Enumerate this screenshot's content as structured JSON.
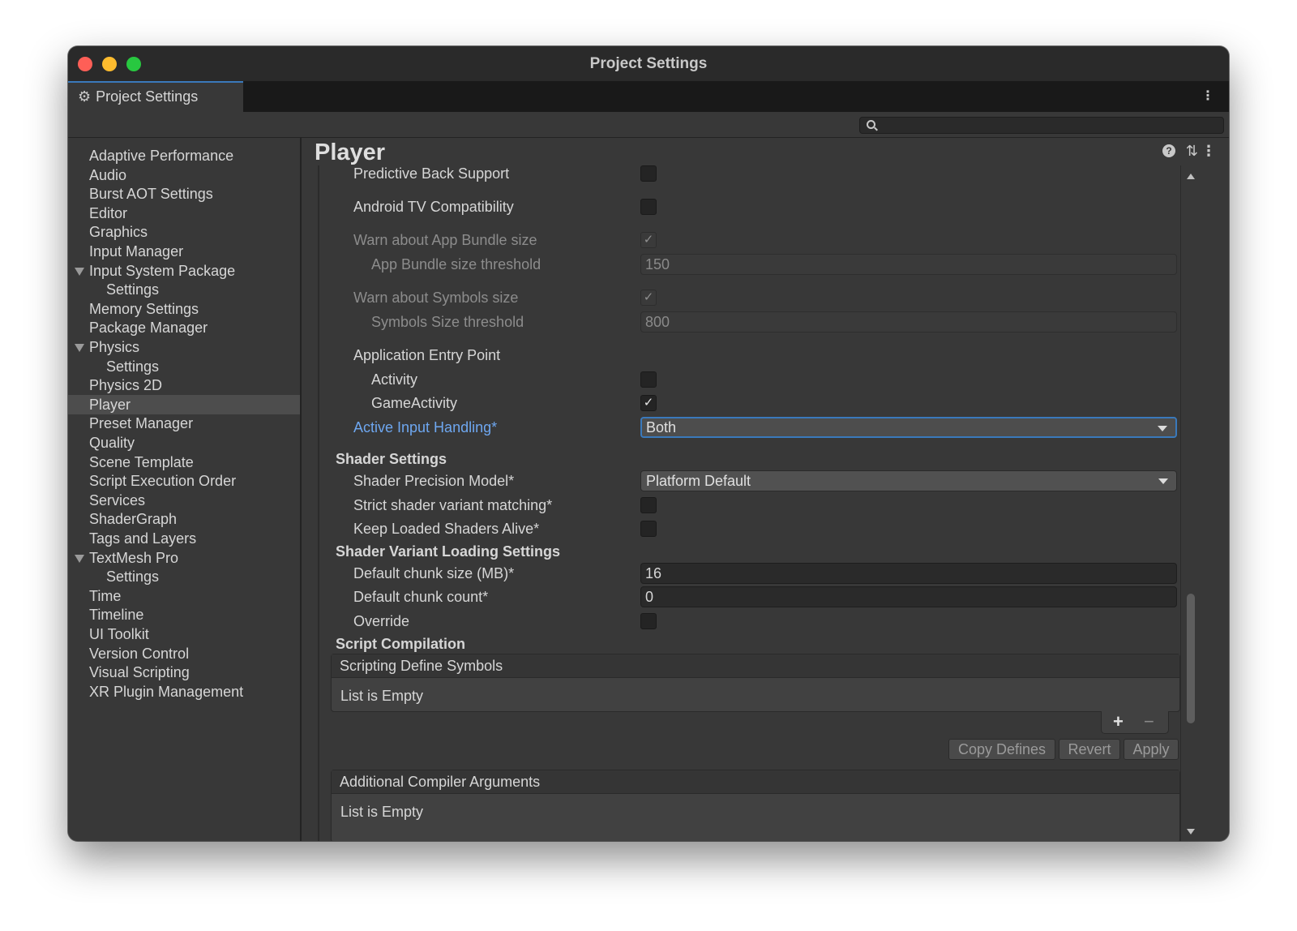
{
  "window": {
    "title": "Project Settings"
  },
  "tab": {
    "label": "Project Settings"
  },
  "sidebar": {
    "items": [
      {
        "label": "Adaptive Performance"
      },
      {
        "label": "Audio"
      },
      {
        "label": "Burst AOT Settings"
      },
      {
        "label": "Editor"
      },
      {
        "label": "Graphics"
      },
      {
        "label": "Input Manager"
      },
      {
        "label": "Input System Package",
        "expanded": true
      },
      {
        "label": "Settings",
        "child": true
      },
      {
        "label": "Memory Settings"
      },
      {
        "label": "Package Manager"
      },
      {
        "label": "Physics",
        "expanded": true
      },
      {
        "label": "Settings",
        "child": true
      },
      {
        "label": "Physics 2D"
      },
      {
        "label": "Player",
        "selected": true
      },
      {
        "label": "Preset Manager"
      },
      {
        "label": "Quality"
      },
      {
        "label": "Scene Template"
      },
      {
        "label": "Script Execution Order"
      },
      {
        "label": "Services"
      },
      {
        "label": "ShaderGraph"
      },
      {
        "label": "Tags and Layers"
      },
      {
        "label": "TextMesh Pro",
        "expanded": true
      },
      {
        "label": "Settings",
        "child": true
      },
      {
        "label": "Time"
      },
      {
        "label": "Timeline"
      },
      {
        "label": "UI Toolkit"
      },
      {
        "label": "Version Control"
      },
      {
        "label": "Visual Scripting"
      },
      {
        "label": "XR Plugin Management"
      }
    ]
  },
  "main": {
    "title": "Player",
    "settings": {
      "predictive_back": {
        "label": "Predictive Back Support",
        "checked": false
      },
      "android_tv": {
        "label": "Android TV Compatibility",
        "checked": false
      },
      "warn_bundle": {
        "label": "Warn about App Bundle size",
        "checked": true
      },
      "bundle_threshold": {
        "label": "App Bundle size threshold",
        "value": "150"
      },
      "warn_symbols": {
        "label": "Warn about Symbols size",
        "checked": true
      },
      "symbols_threshold": {
        "label": "Symbols Size threshold",
        "value": "800"
      },
      "entry_point": {
        "label": "Application Entry Point"
      },
      "activity": {
        "label": "Activity",
        "checked": false
      },
      "game_activity": {
        "label": "GameActivity",
        "checked": true
      },
      "active_input": {
        "label": "Active Input Handling*",
        "value": "Both"
      }
    },
    "shader_settings": {
      "heading": "Shader Settings",
      "precision": {
        "label": "Shader Precision Model*",
        "value": "Platform Default"
      },
      "strict_variant": {
        "label": "Strict shader variant matching*",
        "checked": false
      },
      "keep_loaded": {
        "label": "Keep Loaded Shaders Alive*",
        "checked": false
      }
    },
    "variant_loading": {
      "heading": "Shader Variant Loading Settings",
      "chunk_size": {
        "label": "Default chunk size (MB)*",
        "value": "16"
      },
      "chunk_count": {
        "label": "Default chunk count*",
        "value": "0"
      },
      "override": {
        "label": "Override",
        "checked": false
      }
    },
    "script_compilation": {
      "heading": "Script Compilation",
      "define_symbols": {
        "header": "Scripting Define Symbols",
        "empty": "List is Empty"
      },
      "add_symbol": "+",
      "remove_symbol": "−",
      "buttons": {
        "copy": "Copy Defines",
        "revert": "Revert",
        "apply": "Apply"
      },
      "compiler_args": {
        "header": "Additional Compiler Arguments",
        "empty": "List is Empty"
      }
    }
  },
  "icons": {
    "gear": "⚙",
    "checkmark": "✓",
    "kebab": "⋮",
    "help": "?",
    "sliders": "⇅"
  },
  "colors": {
    "accent": "#3a79bb",
    "link": "#6ea7f0",
    "close": "#fe5f57",
    "minimize": "#febc2e",
    "maximize": "#28c840"
  }
}
